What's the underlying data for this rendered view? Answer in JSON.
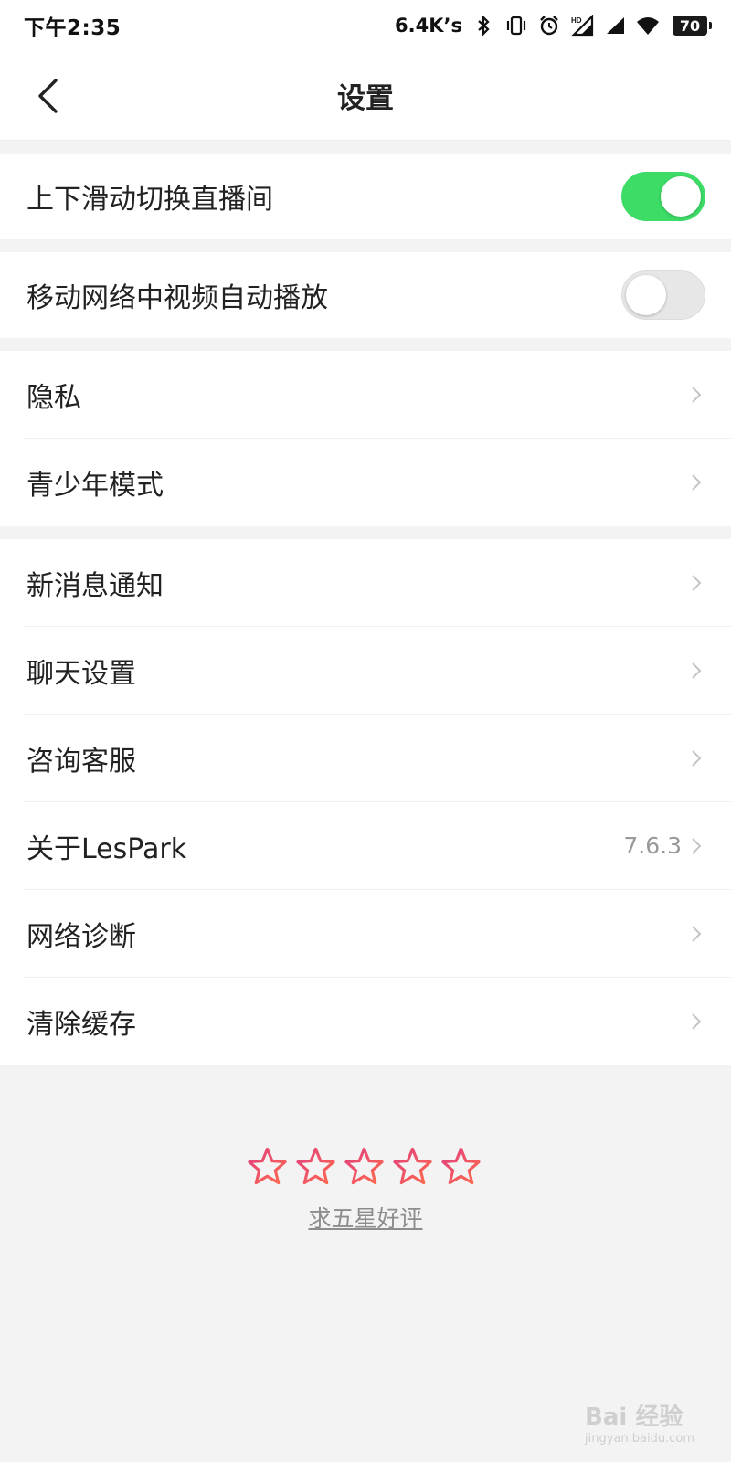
{
  "status_bar": {
    "time": "下午2:35",
    "net_speed": "6.4K’s",
    "battery": "70",
    "icons": [
      "bluetooth-icon",
      "vibrate-icon",
      "alarm-icon",
      "hd-signal-icon",
      "signal-icon",
      "wifi-icon",
      "battery-icon"
    ]
  },
  "header": {
    "title": "设置",
    "back_icon": "chevron-left-icon"
  },
  "toggles": [
    {
      "label": "上下滑动切换直播间",
      "state": "on"
    },
    {
      "label": "移动网络中视频自动播放",
      "state": "off"
    }
  ],
  "group_privacy": [
    {
      "label": "隐私"
    },
    {
      "label": "青少年模式"
    }
  ],
  "group_general": [
    {
      "label": "新消息通知",
      "value": ""
    },
    {
      "label": "聊天设置",
      "value": ""
    },
    {
      "label": "咨询客服",
      "value": ""
    },
    {
      "label": "关于LesPark",
      "value": "7.6.3"
    },
    {
      "label": "网络诊断",
      "value": ""
    },
    {
      "label": "清除缓存",
      "value": ""
    }
  ],
  "rating": {
    "star_count": 5,
    "link_label": "求五星好评"
  },
  "colors": {
    "toggle_on": "#3ddc67",
    "star_gradient_start": "#e0407e",
    "star_gradient_end": "#ff6a4c"
  },
  "watermark": {
    "text": "Bai 经验",
    "sub": "jingyan.baidu.com"
  }
}
